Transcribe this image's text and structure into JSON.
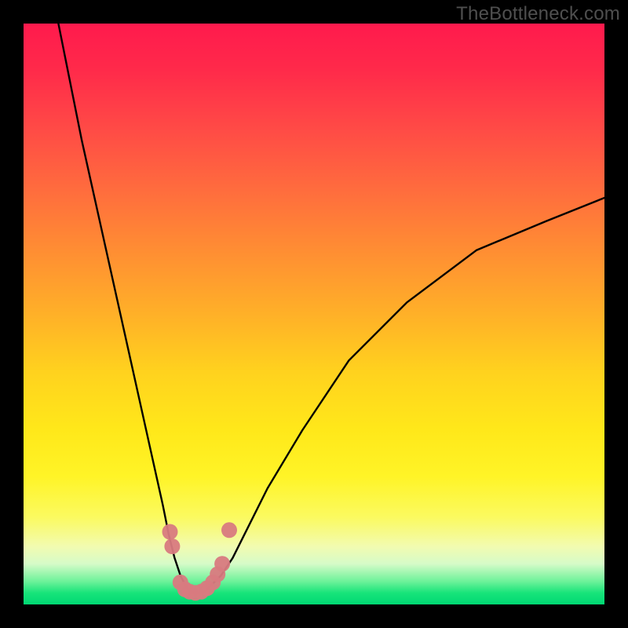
{
  "watermark": "TheBottleneck.com",
  "chart_data": {
    "type": "line",
    "title": "",
    "xlabel": "",
    "ylabel": "",
    "xlim": [
      0,
      100
    ],
    "ylim": [
      0,
      100
    ],
    "gradient_meaning": "background color from red (high bottleneck) at top to green (no bottleneck) at bottom",
    "series": [
      {
        "name": "bottleneck-curve",
        "x": [
          6,
          10,
          14,
          18,
          20,
          22,
          24,
          25,
          26,
          27,
          28,
          29,
          30,
          31,
          32,
          34,
          36,
          38,
          42,
          48,
          56,
          66,
          78,
          90,
          100
        ],
        "y": [
          100,
          80,
          62,
          44,
          35,
          26,
          17,
          12,
          8,
          5,
          3,
          2,
          2,
          2,
          3,
          5,
          8,
          12,
          20,
          30,
          42,
          52,
          61,
          66,
          70
        ]
      }
    ],
    "markers": {
      "name": "highlighted-points",
      "color": "#d87a7f",
      "points": [
        {
          "x": 25.2,
          "y": 12.5
        },
        {
          "x": 25.6,
          "y": 10.0
        },
        {
          "x": 27.0,
          "y": 3.8
        },
        {
          "x": 27.8,
          "y": 2.6
        },
        {
          "x": 28.6,
          "y": 2.2
        },
        {
          "x": 29.6,
          "y": 2.0
        },
        {
          "x": 30.6,
          "y": 2.2
        },
        {
          "x": 31.6,
          "y": 2.8
        },
        {
          "x": 32.6,
          "y": 3.8
        },
        {
          "x": 33.4,
          "y": 5.2
        },
        {
          "x": 34.2,
          "y": 7.0
        },
        {
          "x": 35.4,
          "y": 12.8
        }
      ]
    }
  }
}
